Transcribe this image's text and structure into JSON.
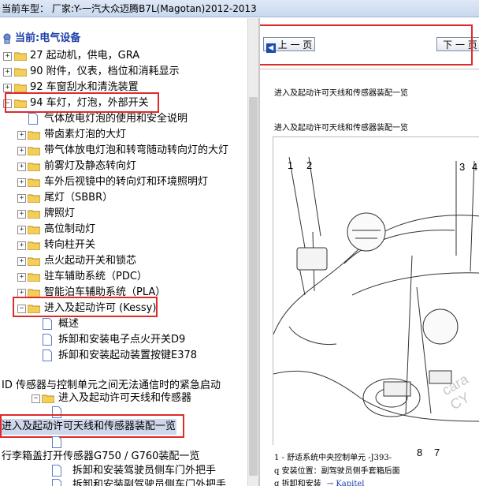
{
  "window": {
    "title": "当前车型：  厂家:Y-一汽大众迈腾B7L(Magotan)2012-2013"
  },
  "tree": {
    "root_label": "当前:电气设备",
    "items": [
      {
        "label": "27 起动机，供电，GRA"
      },
      {
        "label": "90 附件，仪表，档位和消耗显示"
      },
      {
        "label": "92 车窗刮水和清洗装置"
      },
      {
        "label": "94 车灯，灯泡，外部开关"
      },
      {
        "label": "气体放电灯泡的使用和安全说明"
      },
      {
        "label": "带卤素灯泡的大灯"
      },
      {
        "label": "带气体放电灯泡和转弯随动转向灯的大灯"
      },
      {
        "label": "前雾灯及静态转向灯"
      },
      {
        "label": "车外后视镜中的转向灯和环境照明灯"
      },
      {
        "label": "尾灯（SBBR）"
      },
      {
        "label": "牌照灯"
      },
      {
        "label": "高位制动灯"
      },
      {
        "label": "转向柱开关"
      },
      {
        "label": "点火起动开关和锁芯"
      },
      {
        "label": "驻车辅助系统（PDC）"
      },
      {
        "label": "智能泊车辅助系统（PLA）"
      },
      {
        "label": "进入及起动许可 (Kessy)"
      },
      {
        "label": "概述"
      },
      {
        "label": "拆卸和安装电子点火开关D9"
      },
      {
        "label": "拆卸和安装起动装置按键E378"
      },
      {
        "label": "ID 传感器与控制单元之间无法通信时的紧急启动"
      },
      {
        "label": "进入及起动许可天线和传感器"
      },
      {
        "label": "进入及起动许可天线和传感器装配一览"
      },
      {
        "label": "行李箱盖打开传感器G750 / G760装配一览"
      },
      {
        "label": "拆卸和安装驾驶员侧车门外把手"
      },
      {
        "label": "拆卸和安装副驾驶员侧车门外把手"
      }
    ]
  },
  "doc": {
    "prev_label": "上 一 页",
    "next_label": "下 一 页",
    "heading1": "进入及起动许可天线和传感器装配一览",
    "heading2": "进入及起动许可天线和传感器装配一览",
    "callouts": [
      "1",
      "2",
      "3",
      "4",
      "8",
      "7"
    ],
    "legend1": "1 - 舒适系统中央控制单元 -J393-",
    "legend2": "q  安装位置：副驾驶员侧手套箱后面",
    "legend3_prefix": "q  拆卸和安装",
    "legend3_link": "→ Kapitel",
    "watermark": "cara CY"
  }
}
